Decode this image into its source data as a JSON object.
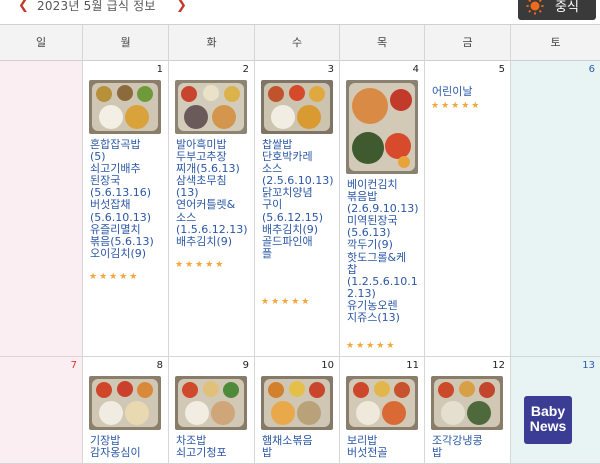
{
  "nav": {
    "title": "2023년 5월 급식 정보",
    "prev": "❮",
    "next": "❯"
  },
  "meal_button": {
    "label": "중식"
  },
  "weekdays": [
    "일",
    "월",
    "화",
    "수",
    "목",
    "금",
    "토"
  ],
  "week1": [
    {
      "day": "",
      "menu": "",
      "stars": ""
    },
    {
      "day": "1",
      "menu": "혼합잡곡밥\n(5)\n쇠고기배추\n된장국\n(5.6.13.16)\n버섯잡채\n(5.6.10.13)\n유즐리멸치\n볶음(5.6.13)\n오이김치(9)",
      "stars": "★★★★★"
    },
    {
      "day": "2",
      "menu": "발아흑미밥\n두부고추장\n찌개(5.6.13)\n삼색초무침\n(13)\n연어커틀렛&\n소스\n(1.5.6.12.13)\n배추김치(9)",
      "stars": "★★★★★"
    },
    {
      "day": "3",
      "menu": "찹쌀밥\n단호박카레\n소스\n(2.5.6.10.13)\n닭꼬치양념\n구이\n(5.6.12.15)\n배추김치(9)\n골드파인애\n플",
      "stars": "★★★★★"
    },
    {
      "day": "4",
      "menu": "베이컨김치\n볶음밥\n(2.6.9.10.13)\n미역된장국\n(5.6.13)\n깍두기(9)\n핫도그롤&케\n찹\n(1.2.5.6.10.1\n2.13)\n유기농오렌\n지쥬스(13)",
      "stars": "★★★★★"
    },
    {
      "day": "5",
      "menu": "어린이날",
      "stars": "★★★★★"
    },
    {
      "day": "6",
      "menu": "",
      "stars": ""
    }
  ],
  "week2": [
    {
      "day": "7",
      "menu": "",
      "stars": ""
    },
    {
      "day": "8",
      "menu": "기장밥\n감자옹심이",
      "stars": ""
    },
    {
      "day": "9",
      "menu": "차조밥\n쇠고기청포",
      "stars": ""
    },
    {
      "day": "10",
      "menu": "햄채소볶음\n밥",
      "stars": ""
    },
    {
      "day": "11",
      "menu": "보리밥\n버섯전골",
      "stars": ""
    },
    {
      "day": "12",
      "menu": "조각강냉콩\n밥",
      "stars": ""
    },
    {
      "day": "13",
      "menu": "",
      "stars": ""
    }
  ],
  "badge": {
    "line1": "Baby",
    "line2": "News"
  },
  "colors": {
    "menu_text": "#2b57a6",
    "sunday_bg": "#fbeef2",
    "saturday_bg": "#e8f3f4",
    "star": "#f4a53b",
    "nav_arrow": "#c0392b"
  }
}
